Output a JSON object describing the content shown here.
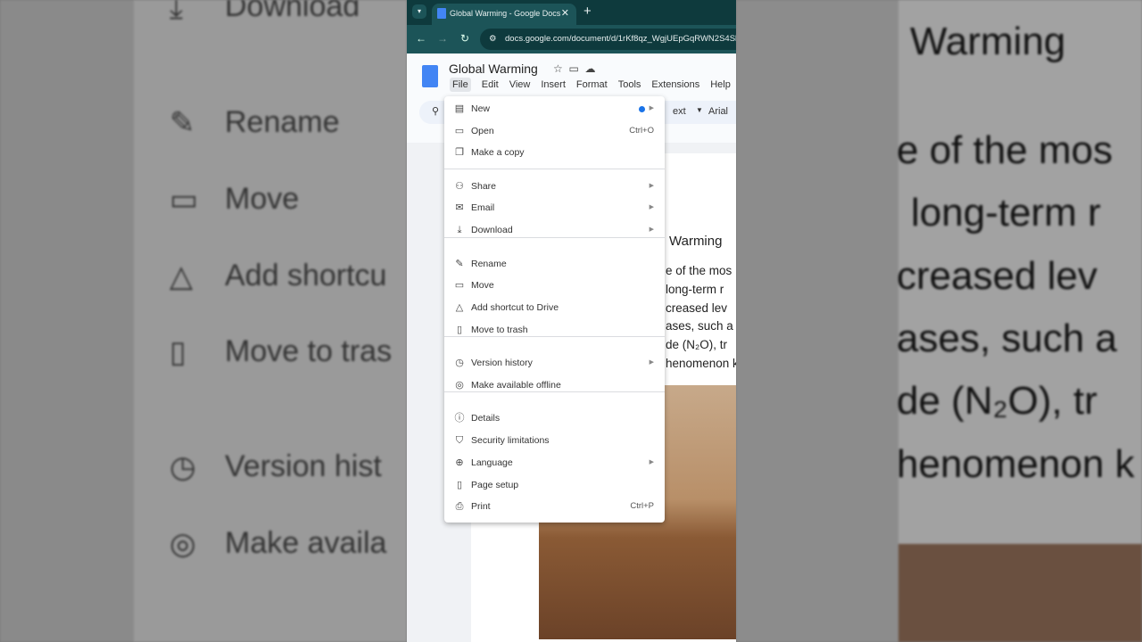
{
  "browser": {
    "tab_title": "Global Warming - Google Docs",
    "url": "docs.google.com/document/d/1rKf8qz_WgjUEpGqRWN2S4Sl"
  },
  "doc": {
    "title": "Global Warming",
    "menubar": [
      "File",
      "Edit",
      "View",
      "Insert",
      "Format",
      "Tools",
      "Extensions",
      "Help"
    ],
    "toolbar_style": "ext",
    "toolbar_font": "Arial",
    "heading_fragment": "Warming",
    "text_lines": [
      "e of the mos",
      " long-term r",
      "creased lev",
      "ases, such a",
      "de (N₂O), tr",
      "henomenon k"
    ]
  },
  "file_menu": [
    {
      "label": "New",
      "icon": "doc-icon",
      "submenu": true,
      "dot": true
    },
    {
      "label": "Open",
      "icon": "folder-icon",
      "shortcut": "Ctrl+O"
    },
    {
      "label": "Make a copy",
      "icon": "copy-icon"
    },
    {
      "label": "Share",
      "icon": "share-person-icon",
      "submenu": true
    },
    {
      "label": "Email",
      "icon": "mail-icon",
      "submenu": true
    },
    {
      "label": "Download",
      "icon": "download-icon",
      "submenu": true
    },
    {
      "label": "Rename",
      "icon": "pencil-icon"
    },
    {
      "label": "Move",
      "icon": "move-folder-icon"
    },
    {
      "label": "Add shortcut to Drive",
      "icon": "drive-shortcut-icon"
    },
    {
      "label": "Move to trash",
      "icon": "trash-icon"
    },
    {
      "label": "Version history",
      "icon": "history-icon",
      "submenu": true
    },
    {
      "label": "Make available offline",
      "icon": "offline-check-icon"
    },
    {
      "label": "Details",
      "icon": "info-icon"
    },
    {
      "label": "Security limitations",
      "icon": "shield-icon"
    },
    {
      "label": "Language",
      "icon": "globe-icon",
      "submenu": true
    },
    {
      "label": "Page setup",
      "icon": "page-icon"
    },
    {
      "label": "Print",
      "icon": "printer-icon",
      "shortcut": "Ctrl+P"
    }
  ],
  "left_zoom": [
    "Download",
    "Rename",
    "Move",
    "Add shortcu",
    "Move to tras",
    "Version hist",
    "Make availa"
  ],
  "right_zoom": [
    "Warming",
    "e of the mos",
    "long-term r",
    "creased lev",
    "ases, such a",
    "de (N₂O), tr",
    "henomenon k"
  ]
}
